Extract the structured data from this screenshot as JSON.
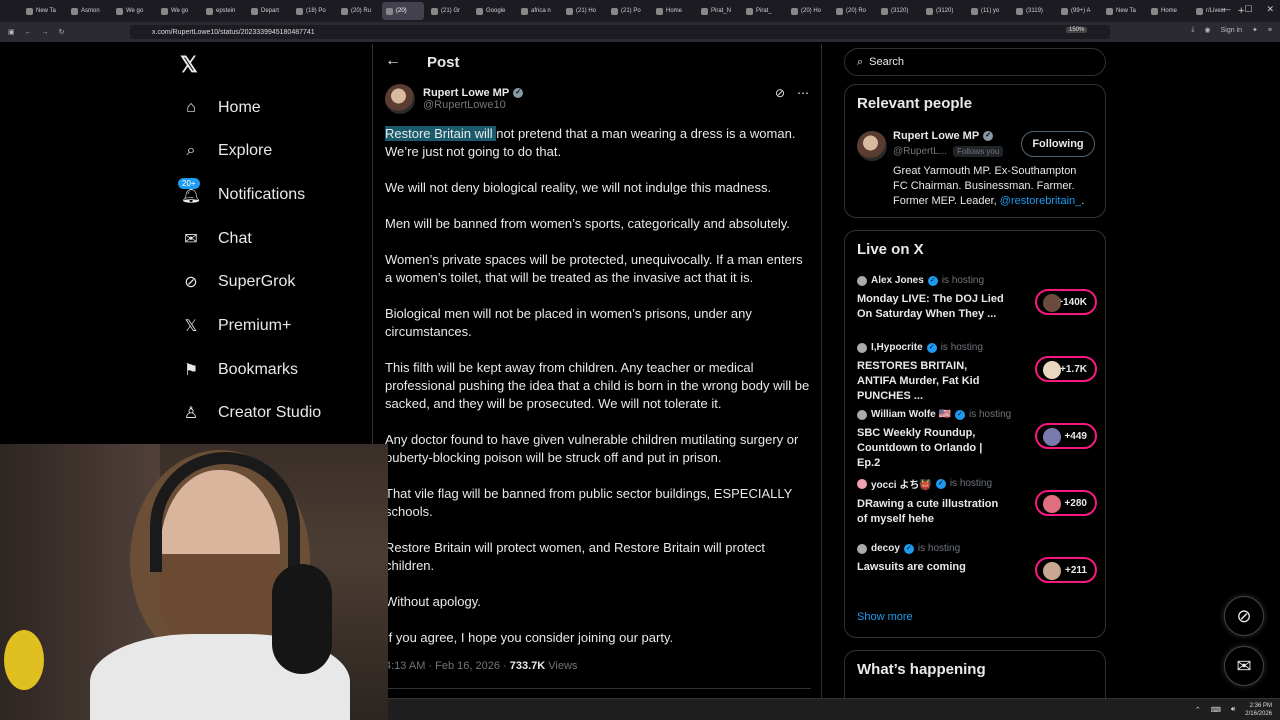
{
  "browser": {
    "tabs": [
      {
        "label": "New Ta"
      },
      {
        "label": "Asmon"
      },
      {
        "label": "We go"
      },
      {
        "label": "We go"
      },
      {
        "label": "epstein"
      },
      {
        "label": "Depart"
      },
      {
        "label": "(18) Po"
      },
      {
        "label": "(20) Ru"
      },
      {
        "label": "(20)"
      },
      {
        "label": "(21) Gr"
      },
      {
        "label": "Google"
      },
      {
        "label": "africa n"
      },
      {
        "label": "(21) Ho"
      },
      {
        "label": "(21) Po"
      },
      {
        "label": "Home"
      },
      {
        "label": "Pirat_N"
      },
      {
        "label": "Pirat_"
      },
      {
        "label": "(20) Ho"
      },
      {
        "label": "(20) Ro"
      },
      {
        "label": "(3120)"
      },
      {
        "label": "(3120)"
      },
      {
        "label": "(11) yo"
      },
      {
        "label": "(3119)"
      },
      {
        "label": "(99+) A"
      },
      {
        "label": "New Ta"
      },
      {
        "label": "Home"
      },
      {
        "label": "r/Livest"
      }
    ],
    "active_tab_index": 8,
    "url": "x.com/RupertLowe10/status/2023339945180487741",
    "zoom": "150%",
    "sign_in": "Sign in"
  },
  "nav": {
    "items": [
      {
        "label": "Home",
        "icon": "home-icon"
      },
      {
        "label": "Explore",
        "icon": "search-icon"
      },
      {
        "label": "Notifications",
        "icon": "bell-icon",
        "badge": "20+"
      },
      {
        "label": "Chat",
        "icon": "mail-icon"
      },
      {
        "label": "SuperGrok",
        "icon": "grok-icon"
      },
      {
        "label": "Premium+",
        "icon": "x-icon"
      },
      {
        "label": "Bookmarks",
        "icon": "bookmark-icon"
      },
      {
        "label": "Creator Studio",
        "icon": "creator-icon"
      }
    ]
  },
  "post": {
    "header_title": "Post",
    "author_name": "Rupert Lowe MP",
    "author_handle": "@RupertLowe10",
    "highlighted_text": "Restore Britain will ",
    "paragraphs": [
      "not pretend that a man wearing a dress is a woman. We’re just not going to do that.",
      "We will not deny biological reality, we will not indulge this madness.",
      "Men will be banned from women’s sports, categorically and absolutely.",
      "Women’s private spaces will be protected, unequivocally. If a man enters a women’s toilet, that will be treated as the invasive act that it is.",
      "Biological men will not be placed in women’s prisons, under any circumstances.",
      "This filth will be kept away from children. Any teacher or medical professional pushing the idea that a child is born in the wrong body will be sacked, and they will be prosecuted. We will not tolerate it.",
      "Any doctor found to have given vulnerable children mutilating surgery or puberty-blocking poison will be struck off and put in prison.",
      "That vile flag will be banned from public sector buildings, ESPECIALLY schools.",
      "Restore Britain will protect women, and Restore Britain will protect children.",
      "Without apology.",
      "If you agree, I hope you consider joining our party."
    ],
    "time": "4:13 AM · Feb 16, 2026 · ",
    "views_count": "733.7K",
    "views_label": " Views"
  },
  "search": {
    "placeholder": "Search"
  },
  "relevant_people": {
    "title": "Relevant people",
    "name": "Rupert Lowe MP",
    "handle": "@RupertL...",
    "follows_you": "Follows you",
    "button": "Following",
    "bio": "Great Yarmouth MP. Ex-Southampton FC Chairman. Businessman. Farmer. Former MEP. Leader, ",
    "bio_link": "@restorebritain_",
    "bio_end": "."
  },
  "live": {
    "title": "Live on X",
    "hosting_label": "is hosting",
    "items": [
      {
        "host": "Alex Jones",
        "title": "Monday LIVE: The DOJ Lied On Saturday When They ...",
        "count": "+140K"
      },
      {
        "host": "I,Hypocrite",
        "title": "RESTORES BRITAIN, ANTIFA Murder, Fat Kid PUNCHES ...",
        "count": "+1.7K"
      },
      {
        "host": "William Wolfe 🇺🇸",
        "title": "SBC Weekly Roundup, Countdown to Orlando | Ep.2",
        "count": "+449"
      },
      {
        "host": "yocci よち👹",
        "title": "DRawing a cute illustration of myself hehe",
        "count": "+280"
      },
      {
        "host": "decoy",
        "title": "Lawsuits are coming",
        "count": "+211"
      }
    ],
    "show_more": "Show more"
  },
  "whats_happening": {
    "title": "What’s happening"
  },
  "taskbar": {
    "time": "2:36 PM",
    "date": "2/16/2026"
  },
  "colors": {
    "accent": "#1d9bf0",
    "live": "#f91880",
    "highlight": "#1a5a6a"
  }
}
